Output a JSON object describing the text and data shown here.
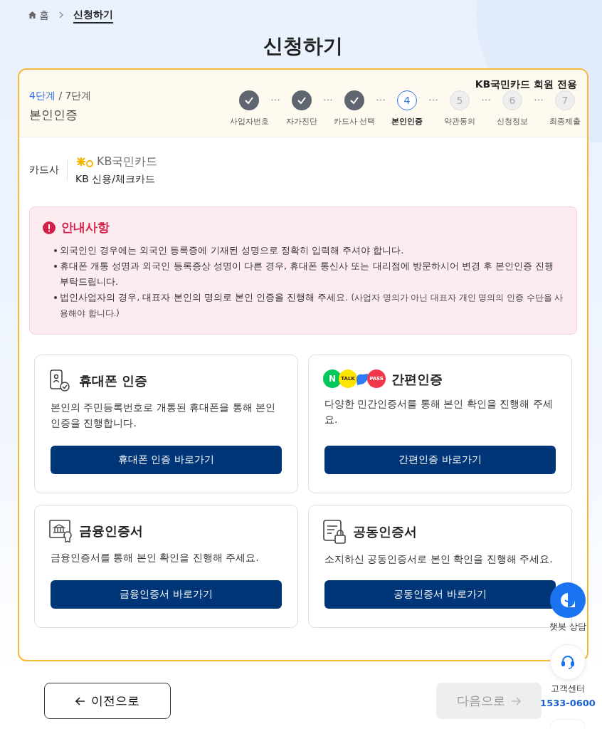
{
  "breadcrumb": {
    "home": "홈",
    "current": "신청하기"
  },
  "title": "신청하기",
  "progress": {
    "current_label": "4단계",
    "total_label": "/ 7단계",
    "step_name": "본인인증",
    "member_note": "KB국민카드 회원 전용",
    "steps": [
      {
        "label": "사업자번호",
        "completed": true,
        "selected": false
      },
      {
        "label": "자가진단",
        "completed": true,
        "selected": false
      },
      {
        "label": "카드사 선택",
        "completed": true,
        "selected": false
      },
      {
        "number": "4",
        "label": "본인인증",
        "completed": false,
        "selected": true
      },
      {
        "number": "5",
        "label": "약관동의",
        "completed": false,
        "selected": false
      },
      {
        "number": "6",
        "label": "신청정보",
        "completed": false,
        "selected": false
      },
      {
        "number": "7",
        "label": "최종제출",
        "completed": false,
        "selected": false
      }
    ]
  },
  "card_company": {
    "label": "카드사",
    "logo_text": "KB국민카드",
    "name": "KB 신용/체크카드"
  },
  "notice": {
    "title": "안내사항",
    "items": [
      {
        "text": "외국인인 경우에는 외국인 등록증에 기재된 성명으로 정확히 입력해 주셔야 합니다."
      },
      {
        "text": "휴대폰 개통 성명과 외국인 등록증상 성명이 다른 경우, 휴대폰 통신사 또는 대리점에 방문하시어 변경 후 본인인증 진행 부탁드립니다."
      },
      {
        "text": "법인사업자의 경우, 대표자 본인의 명의로 본인 인증을 진행해 주세요.",
        "note": "(사업자 명의가 아닌 대표자 개인 명의의 인증 수단을 사용해야 합니다.)"
      }
    ]
  },
  "methods": [
    {
      "kind": "phone",
      "title": "휴대폰 인증",
      "description": "본인의 주민등록번호로 개통된 휴대폰을 통해 본인 인증을 진행합니다.",
      "button": "휴대폰 인증 바로가기"
    },
    {
      "kind": "simple",
      "title": "간편인증",
      "badges": [
        {
          "label": "N",
          "color": "#03c75a"
        },
        {
          "label": "TALK",
          "color": "#fee500"
        },
        {
          "label": "PASS",
          "color": "#f0384b"
        }
      ],
      "description": "다양한 민간인증서를 통해 본인 확인을 진행해 주세요.",
      "button": "간편인증 바로가기"
    },
    {
      "kind": "financial",
      "title": "금융인증서",
      "description": "금융인증서를 통해 본인 확인을 진행해 주세요.",
      "button": "금융인증서 바로가기"
    },
    {
      "kind": "joint",
      "title": "공동인증서",
      "description": "소지하신 공동인증서로 본인 확인을 진행해 주세요.",
      "button": "공동인증서 바로가기"
    }
  ],
  "nav": {
    "prev": "이전으로",
    "next": "다음으로",
    "next_disabled": true
  },
  "floating": {
    "chatbot": "챗봇 상담",
    "center": "고객센터",
    "phone": "1533-0600"
  }
}
